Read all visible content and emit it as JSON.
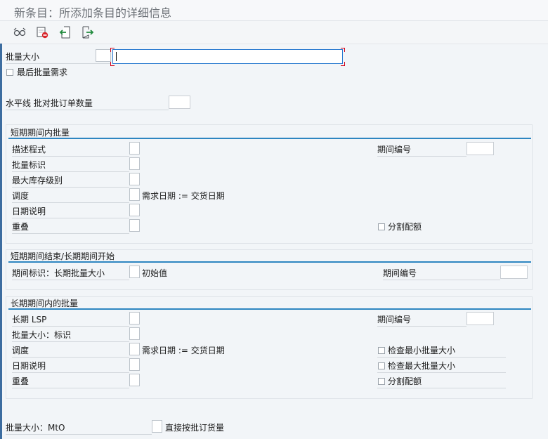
{
  "title": "新条目：所添加条目的详细信息",
  "toolbar": {
    "buttons": [
      {
        "name": "glasses-icon"
      },
      {
        "name": "delete-icon"
      },
      {
        "name": "previous-entry-icon"
      },
      {
        "name": "next-entry-icon"
      }
    ]
  },
  "top": {
    "lot_size_label": "批量大小",
    "last_lot_label": "最后批量需求",
    "horizon_label": "水平线 批对批订单数量"
  },
  "short_term": {
    "title": "短期期间内批量",
    "descriptor_label": "描述程式",
    "lot_indicator_label": "批量标识",
    "max_stock_label": "最大库存级别",
    "scheduling_label": "调度",
    "scheduling_value": "需求日期 := 交货日期",
    "date_spec_label": "日期说明",
    "overlap_label": "重叠",
    "period_no_label": "期间编号",
    "split_quota_label": "分割配额"
  },
  "transition": {
    "title": "短期期间结束/长期期间开始",
    "period_indicator_label": "期间标识：长期批量大小",
    "initial_value": "初始值",
    "period_no_label": "期间编号"
  },
  "long_term": {
    "title": "长期期间内的批量",
    "lsp_label": "长期 LSP",
    "lot_size_ind_label": "批量大小：标识",
    "scheduling_label": "调度",
    "scheduling_value": "需求日期 := 交货日期",
    "date_spec_label": "日期说明",
    "overlap_label": "重叠",
    "period_no_label": "期间编号",
    "check_min_label": "检查最小批量大小",
    "check_max_label": "检查最大批量大小",
    "split_quota_label": "分割配额"
  },
  "bottom": {
    "mto_label": "批量大小：MtO",
    "direct_order_label": "直接按批订货量"
  }
}
